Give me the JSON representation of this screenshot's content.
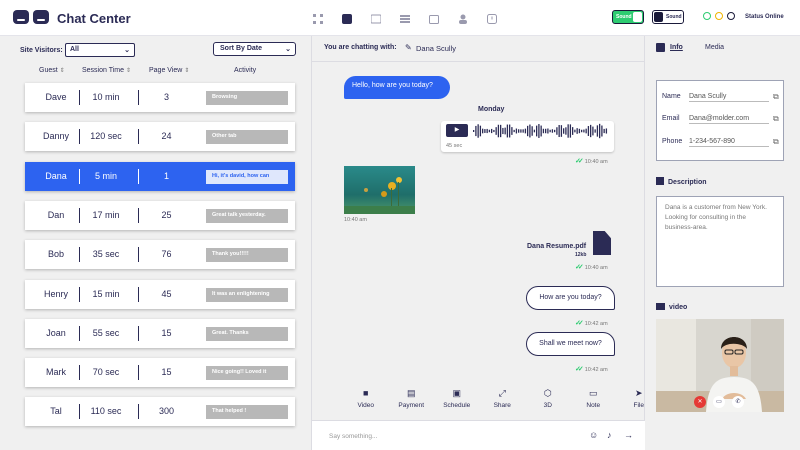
{
  "header": {
    "title": "Chat Center",
    "nav_icons": [
      "grid-icon",
      "chat-icon",
      "card-icon",
      "list-icon",
      "calendar-icon",
      "user-icon",
      "alert-icon"
    ],
    "toggle_on_label": "Sound",
    "toggle_off_label": "Sound",
    "status_colors": [
      "#2ecc71",
      "#f0b400",
      "#1a1a3a"
    ],
    "status_text": "Status Online"
  },
  "left": {
    "site_visitors_label": "Site Visitors:",
    "filter_value": "All",
    "sort_value": "Sort By Date",
    "columns": [
      "Guest",
      "Session Time",
      "Page View",
      "Activity"
    ],
    "rows": [
      {
        "name": "Dave",
        "time": "10 min",
        "views": "3",
        "activity": "Browsing"
      },
      {
        "name": "Danny",
        "time": "120 sec",
        "views": "24",
        "activity": "Other tab"
      },
      {
        "name": "Dana",
        "time": "5 min",
        "views": "1",
        "activity": "Hi, it's david, how can"
      },
      {
        "name": "Dan",
        "time": "17 min",
        "views": "25",
        "activity": "Great talk yesterday."
      },
      {
        "name": "Bob",
        "time": "35 sec",
        "views": "76",
        "activity": "Thank you!!!!!"
      },
      {
        "name": "Henry",
        "time": "15 min",
        "views": "45",
        "activity": "It was an enlightening"
      },
      {
        "name": "Joan",
        "time": "55 sec",
        "views": "15",
        "activity": "Great. Thanks"
      },
      {
        "name": "Mark",
        "time": "70 sec",
        "views": "15",
        "activity": "Nice going!! Loved it"
      },
      {
        "name": "Tal",
        "time": "110 sec",
        "views": "300",
        "activity": "That helped !"
      }
    ],
    "active_row": 2
  },
  "chat": {
    "chatting_with_label": "You are chatting with:",
    "contact_name": "Dana Scully",
    "msg1": "Hello, how are you today?",
    "day_label": "Monday",
    "audio_duration": "45 sec",
    "audio_time": "10:40 am",
    "photo_time": "10:40 am",
    "file_name": "Dana Resume.pdf",
    "file_size": "12kb",
    "file_time": "10:40 am",
    "msg2": "How are you today?",
    "msg2_time": "10:42 am",
    "msg3": "Shall we meet now?",
    "msg3_time": "10:42 am",
    "tools": [
      {
        "icon": "video-icon",
        "label": "Video",
        "glyph": "■"
      },
      {
        "icon": "payment-icon",
        "label": "Payment",
        "glyph": "▤"
      },
      {
        "icon": "schedule-icon",
        "label": "Schedule",
        "glyph": "▣"
      },
      {
        "icon": "share-icon",
        "label": "Share",
        "glyph": "⤢"
      },
      {
        "icon": "3d-icon",
        "label": "3D",
        "glyph": "⬡"
      },
      {
        "icon": "note-icon",
        "label": "Note",
        "glyph": "▭"
      },
      {
        "icon": "file-icon",
        "label": "File",
        "glyph": "➤"
      }
    ],
    "composer_placeholder": "Say something..."
  },
  "info": {
    "tab_info": "Info",
    "tab_media": "Media",
    "name_label": "Name",
    "name_value": "Dana Scully",
    "email_label": "Email",
    "email_value": "Dana@molder.com",
    "phone_label": "Phone",
    "phone_value": "1-234-567-890",
    "description_title": "Description",
    "description_text": "Dana is a customer from New York. Looking for consulting in the business-area.",
    "video_title": "video"
  },
  "colors": {
    "primary": "#2d63f0",
    "navy": "#2b2b55",
    "green": "#2ecc71",
    "end_call": "#e53935"
  }
}
